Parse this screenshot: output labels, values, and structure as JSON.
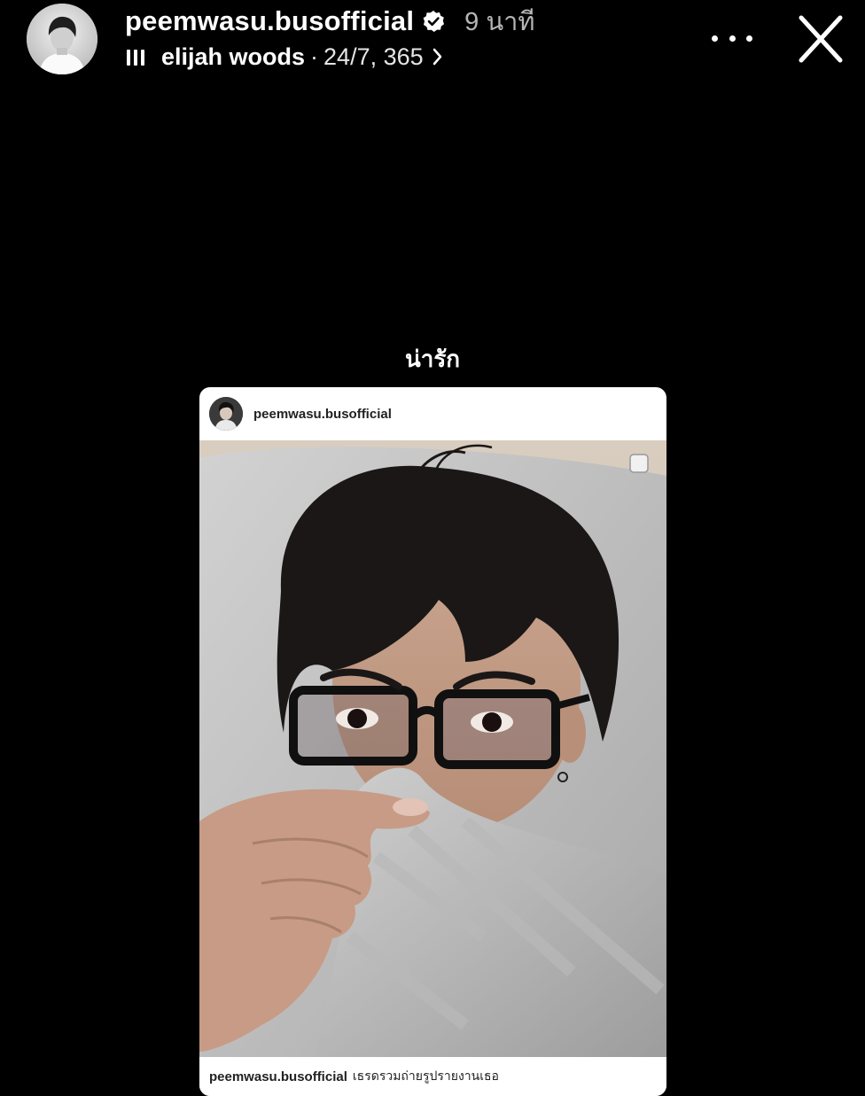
{
  "story_header": {
    "username": "peemwasu.busofficial",
    "time_ago": "9 นาที",
    "music": {
      "song": "elijah woods",
      "separator": "·",
      "album": "24/7, 365"
    }
  },
  "icons": {
    "verified": "verified-badge-icon",
    "music": "music-bars-icon",
    "chevron": "chevron-right-icon",
    "more": "more-options-icon",
    "close": "close-icon"
  },
  "caption": "น่ารัก",
  "shared_post": {
    "username": "peemwasu.busofficial",
    "footer_username": "peemwasu.busofficial",
    "footer_caption": "เธรดรวมถ่ายรูปรายงานเธอ"
  },
  "colors": {
    "background": "#000000",
    "text_primary": "#ffffff",
    "text_secondary": "#b5b5b5",
    "card_background": "#ffffff"
  }
}
